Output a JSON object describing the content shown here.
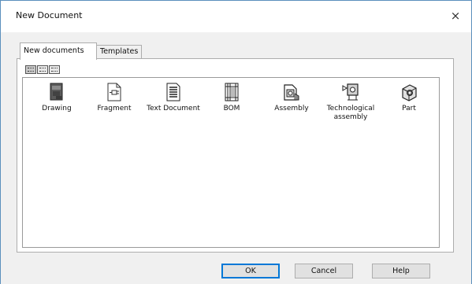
{
  "window": {
    "title": "New Document",
    "close_symbol": "×"
  },
  "tabs": [
    {
      "label": "New documents",
      "active": true
    },
    {
      "label": "Templates",
      "active": false
    }
  ],
  "view_toolbar": {
    "buttons": [
      {
        "icon": "large-icons-view-icon"
      },
      {
        "icon": "list-view-icon"
      },
      {
        "icon": "details-view-icon"
      }
    ]
  },
  "documents": [
    {
      "label": "Drawing",
      "icon": "drawing-icon"
    },
    {
      "label": "Fragment",
      "icon": "fragment-icon"
    },
    {
      "label": "Text Document",
      "icon": "text-document-icon"
    },
    {
      "label": "BOM",
      "icon": "bom-icon"
    },
    {
      "label": "Assembly",
      "icon": "assembly-icon"
    },
    {
      "label": "Technological assembly",
      "icon": "technological-assembly-icon"
    },
    {
      "label": "Part",
      "icon": "part-icon"
    }
  ],
  "buttons": {
    "ok": "OK",
    "cancel": "Cancel",
    "help": "Help"
  },
  "colors": {
    "accent": "#0078d7",
    "background": "#7ab8e0",
    "dialog": "#f0f0f0"
  }
}
